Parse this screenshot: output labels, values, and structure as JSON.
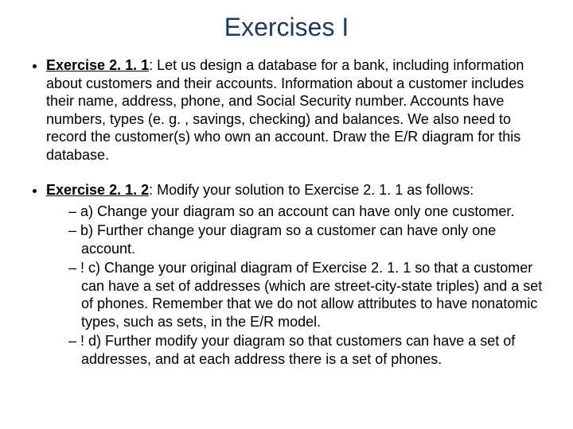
{
  "title": "Exercises I",
  "ex1": {
    "label": "Exercise 2. 1. 1",
    "text": ": Let us design a database for a bank, including information about customers and their accounts. Information about a customer includes their name, address, phone, and Social Security number. Accounts have numbers, types (e. g. , savings, checking) and balances. We also need to record the customer(s) who own an account. Draw the E/R diagram for this database."
  },
  "ex2": {
    "label": "Exercise 2. 1. 2",
    "text": ": Modify your solution to Exercise 2. 1. 1 as follows:",
    "subs": {
      "a": "a) Change your diagram so an account can have only one customer.",
      "b": "b) Further change your diagram so a customer can have only one account.",
      "c": "! c) Change your original diagram of Exercise 2. 1. 1 so that a customer can have a set of addresses (which are street-city-state triples) and a set of phones. Remember that we do not allow attributes to have nonatomic types, such as sets, in the E/R model.",
      "d": "! d) Further modify your diagram so that customers can have a set of addresses, and at each address there is a set of phones."
    }
  }
}
